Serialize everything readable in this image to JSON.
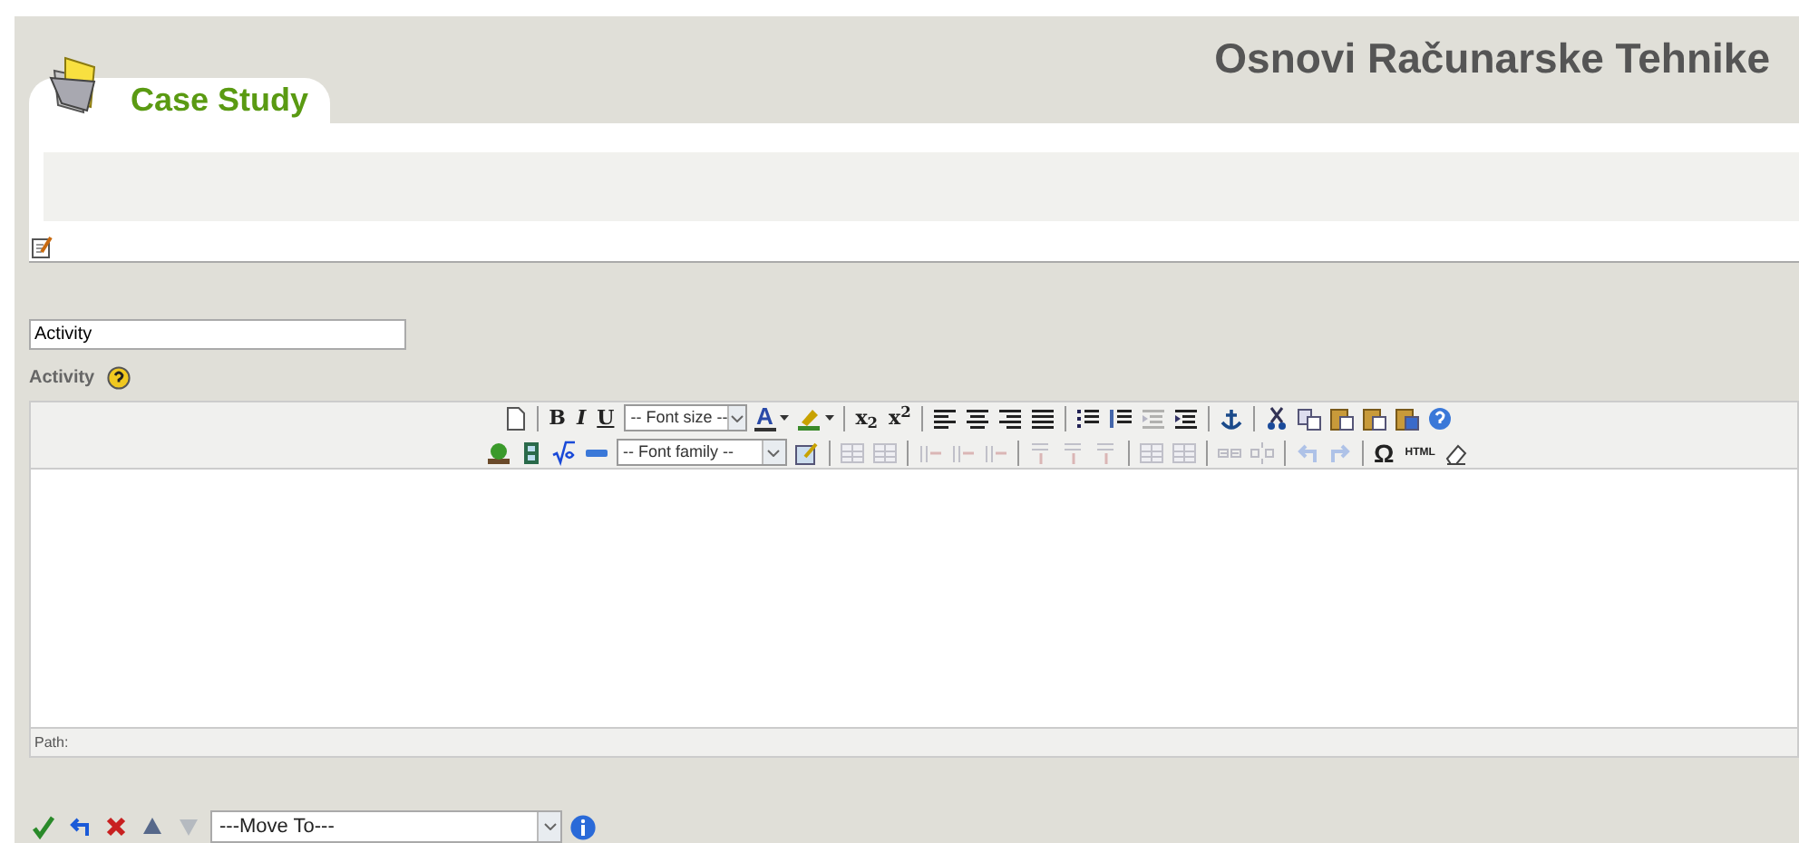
{
  "header": {
    "title": "Osnovi Računarske Tehnike"
  },
  "tab": {
    "label": "Case Study",
    "selected": true
  },
  "field": {
    "value": "Activity"
  },
  "field_label": {
    "text": "Activity"
  },
  "formatting_toolbar": [
    {
      "kind": "button",
      "disabled": false
    },
    {
      "kind": "separator"
    },
    {
      "kind": "glyph",
      "label": "B",
      "disabled": false
    },
    {
      "kind": "glyph",
      "label": "I",
      "disabled": false
    },
    {
      "kind": "glyph",
      "label": "U",
      "disabled": false
    },
    {
      "kind": "select",
      "value": "-- Font size --"
    },
    {
      "kind": "split",
      "label": "A"
    },
    {
      "kind": "split"
    },
    {
      "kind": "separator"
    },
    {
      "kind": "glyph",
      "label": "x$_{2}$",
      "disabled": false
    },
    {
      "kind": "glyph",
      "label": "x$^{2}$",
      "disabled": false
    },
    {
      "kind": "separator"
    },
    {
      "kind": "button",
      "disabled": false
    },
    {
      "kind": "button",
      "disabled": false
    },
    {
      "kind": "button",
      "disabled": false
    },
    {
      "kind": "button",
      "disabled": false
    },
    {
      "kind": "separator"
    },
    {
      "kind": "button",
      "disabled": false
    },
    {
      "kind": "button",
      "disabled": false
    },
    {
      "kind": "button",
      "disabled": true
    },
    {
      "kind": "button",
      "disabled": false
    },
    {
      "kind": "separator"
    },
    {
      "kind": "button",
      "disabled": false
    },
    {
      "kind": "separator"
    },
    {
      "kind": "button",
      "disabled": false
    },
    {
      "kind": "button",
      "disabled": false
    },
    {
      "kind": "button",
      "disabled": false
    },
    {
      "kind": "button",
      "disabled": false
    },
    {
      "kind": "button",
      "disabled": false
    },
    {
      "kind": "button",
      "disabled": false
    }
  ],
  "insert_toolbar": [
    {
      "kind": "button",
      "disabled": false
    },
    {
      "kind": "button",
      "disabled": false
    },
    {
      "kind": "button",
      "disabled": false
    },
    {
      "kind": "button",
      "disabled": false
    },
    {
      "kind": "select",
      "value": "-- Font family --"
    },
    {
      "kind": "button",
      "disabled": false
    },
    {
      "kind": "separator"
    },
    {
      "kind": "button",
      "disabled": true
    },
    {
      "kind": "button",
      "disabled": true
    },
    {
      "kind": "separator"
    },
    {
      "kind": "button",
      "disabled": true
    },
    {
      "kind": "button",
      "disabled": true
    },
    {
      "kind": "button",
      "disabled": true
    },
    {
      "kind": "separator"
    },
    {
      "kind": "button",
      "disabled": true
    },
    {
      "kind": "button",
      "disabled": true
    },
    {
      "kind": "button",
      "disabled": true
    },
    {
      "kind": "separator"
    },
    {
      "kind": "button",
      "disabled": true
    },
    {
      "kind": "button",
      "disabled": true
    },
    {
      "kind": "separator"
    },
    {
      "kind": "button",
      "disabled": true
    },
    {
      "kind": "button",
      "disabled": true
    },
    {
      "kind": "separator"
    },
    {
      "kind": "button",
      "disabled": true
    },
    {
      "kind": "button",
      "disabled": true
    },
    {
      "kind": "separator"
    },
    {
      "kind": "glyph",
      "label": "Ω",
      "disabled": false
    },
    {
      "kind": "glyph",
      "label": "HTML",
      "disabled": false
    },
    {
      "kind": "button",
      "disabled": false
    }
  ],
  "status": {
    "path_label": "Path:"
  },
  "actions": [
    {
      "disabled": false
    },
    {
      "disabled": false
    },
    {
      "disabled": false
    },
    {
      "disabled": false
    },
    {
      "disabled": true
    }
  ],
  "move_select": {
    "value": "---Move To---"
  }
}
